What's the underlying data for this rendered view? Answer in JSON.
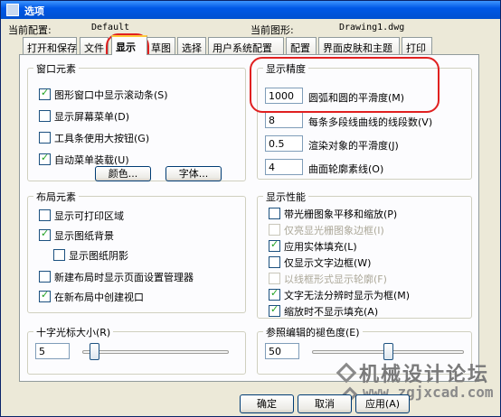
{
  "window": {
    "title": "选项"
  },
  "info": {
    "profile_label": "当前配置:",
    "profile_value": "Default",
    "drawing_label": "当前图形:",
    "drawing_value": "Drawing1.dwg"
  },
  "tabs": [
    {
      "label": "打开和保存",
      "active": false
    },
    {
      "label": "文件",
      "active": false
    },
    {
      "label": "显示",
      "active": true
    },
    {
      "label": "草图",
      "active": false
    },
    {
      "label": "选择",
      "active": false
    },
    {
      "label": "用户系统配置",
      "active": false
    },
    {
      "label": "配置",
      "active": false
    },
    {
      "label": "界面皮肤和主题",
      "active": false
    },
    {
      "label": "打印",
      "active": false
    }
  ],
  "window_elements": {
    "title": "窗口元素",
    "items": [
      {
        "label": "图形窗口中显示滚动条(S)",
        "checked": true
      },
      {
        "label": "显示屏幕菜单(D)",
        "checked": false
      },
      {
        "label": "工具条使用大按钮(G)",
        "checked": false
      },
      {
        "label": "自动菜单装载(U)",
        "checked": true
      }
    ],
    "colors_button": "颜色...",
    "fonts_button": "字体..."
  },
  "layout_elements": {
    "title": "布局元素",
    "items": [
      {
        "label": "显示可打印区域",
        "checked": false
      },
      {
        "label": "显示图纸背景",
        "checked": true
      },
      {
        "label": "显示图纸阴影",
        "checked": false
      },
      {
        "label": "新建布局时显示页面设置管理器",
        "checked": false
      },
      {
        "label": "在新布局中创建视口",
        "checked": true
      }
    ]
  },
  "crosshair": {
    "title": "十字光标大小(R)",
    "value": "5",
    "slider_level_fraction": 0.05
  },
  "display_resolution": {
    "title": "显示精度",
    "rows": [
      {
        "value": "1000",
        "label": "圆弧和圆的平滑度(M)"
      },
      {
        "value": "8",
        "label": "每条多段线曲线的线段数(V)"
      },
      {
        "value": "0.5",
        "label": "渲染对象的平滑度(J)"
      },
      {
        "value": "4",
        "label": "曲面轮廓素线(O)"
      }
    ]
  },
  "display_performance": {
    "title": "显示性能",
    "items": [
      {
        "label": "带光栅图象平移和缩放(P)",
        "checked": false,
        "disabled": false
      },
      {
        "label": "仅亮显光栅图象边框(I)",
        "checked": false,
        "disabled": true
      },
      {
        "label": "应用实体填充(L)",
        "checked": true,
        "disabled": false
      },
      {
        "label": "仅显示文字边框(W)",
        "checked": false,
        "disabled": false
      },
      {
        "label": "以线框形式显示轮廓(F)",
        "checked": false,
        "disabled": true
      },
      {
        "label": "文字无法分辨时显示为框(M)",
        "checked": true,
        "disabled": false
      },
      {
        "label": "缩放时不显示填充(A)",
        "checked": true,
        "disabled": false
      }
    ]
  },
  "reference_fade": {
    "title": "参照编辑的褪色度(E)",
    "value": "50",
    "slider_level_fraction": 0.5
  },
  "buttons": {
    "ok": "确定",
    "cancel": "取消",
    "apply": "应用(A)"
  },
  "watermark": {
    "text": "机械设计论坛",
    "url": "www.zgjxcad.com"
  },
  "colors": {
    "highlight_ring": "#e02020",
    "title_bar": "#0058e6"
  }
}
